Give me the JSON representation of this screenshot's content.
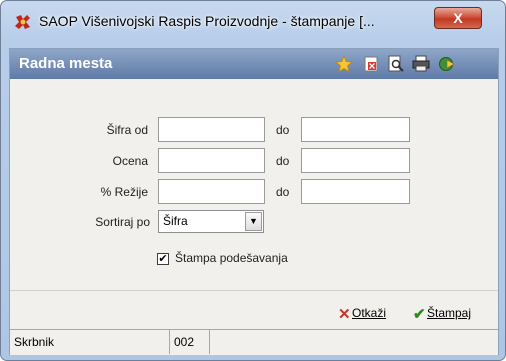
{
  "window": {
    "title": "SAOP Višenivojski Raspis Proizvodnje - štampanje [...",
    "close_symbol": "X"
  },
  "header": {
    "title": "Radna mesta",
    "icons": [
      "star-icon",
      "close-document-icon",
      "print-preview-icon",
      "printer-icon",
      "export-icon"
    ]
  },
  "form": {
    "sifra_label": "Šifra od",
    "ocena_label": "Ocena",
    "rezije_label": "% Režije",
    "do_label": "do",
    "sifra_from": "",
    "sifra_to": "",
    "ocena_from": "",
    "ocena_to": "",
    "rezije_from": "",
    "rezije_to": "",
    "sort_label": "Sortiraj po",
    "sort_value": "Šifra",
    "print_settings_label": "Štampa podešavanja",
    "print_settings_checked": "✔"
  },
  "actions": {
    "cancel_label": "Otkaži",
    "print_label": "Štampaj"
  },
  "status": {
    "user": "Skrbnik",
    "code": "002",
    "extra": ""
  },
  "colors": {
    "header_top": "#8fa6c9",
    "header_bottom": "#5e7aa6",
    "cancel_icon": "#c0392b",
    "print_icon": "#2e8b1e"
  }
}
